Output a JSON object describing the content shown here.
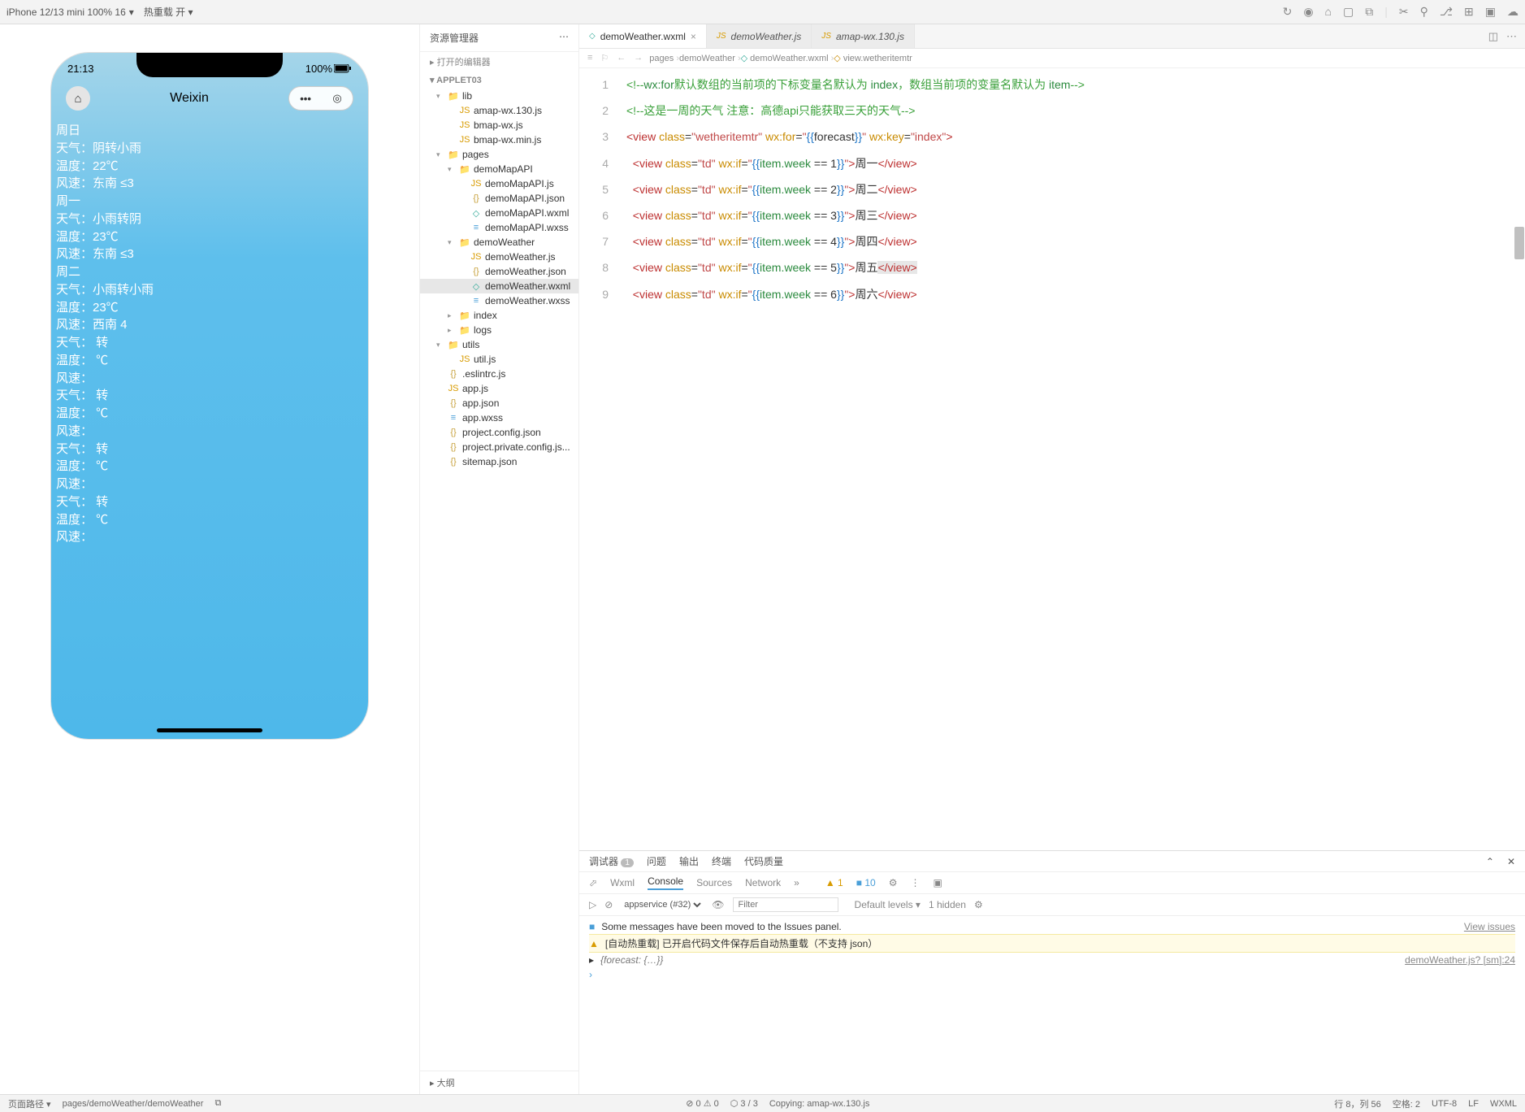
{
  "topbar": {
    "device": "iPhone 12/13 mini 100% 16",
    "reload": "热重载 开"
  },
  "simulator": {
    "time": "21:13",
    "battery": "100%",
    "title": "Weixin",
    "weather_lines": [
      "周日",
      "天气：阴转小雨",
      "温度：22℃",
      "风速：东南 ≤3",
      "周一",
      "天气：小雨转阴",
      "温度：23℃",
      "风速：东南 ≤3",
      "周二",
      "天气：小雨转小雨",
      "温度：23℃",
      "风速：西南 4",
      "天气： 转",
      "温度： ℃",
      "风速：",
      "天气： 转",
      "温度： ℃",
      "风速：",
      "天气： 转",
      "温度： ℃",
      "风速：",
      "天气： 转",
      "温度： ℃",
      "风速："
    ]
  },
  "explorer": {
    "title": "资源管理器",
    "open_editors": "打开的编辑器",
    "root": "APPLET03",
    "outline": "大纲",
    "tree": [
      {
        "d": 1,
        "chev": "▾",
        "ico": "fold",
        "name": "lib"
      },
      {
        "d": 2,
        "ico": "js",
        "name": "amap-wx.130.js"
      },
      {
        "d": 2,
        "ico": "js",
        "name": "bmap-wx.js"
      },
      {
        "d": 2,
        "ico": "js",
        "name": "bmap-wx.min.js"
      },
      {
        "d": 1,
        "chev": "▾",
        "ico": "fold",
        "name": "pages"
      },
      {
        "d": 2,
        "chev": "▾",
        "ico": "fold",
        "name": "demoMapAPI"
      },
      {
        "d": 3,
        "ico": "js",
        "name": "demoMapAPI.js"
      },
      {
        "d": 3,
        "ico": "json",
        "name": "demoMapAPI.json"
      },
      {
        "d": 3,
        "ico": "wxml",
        "name": "demoMapAPI.wxml"
      },
      {
        "d": 3,
        "ico": "wxss",
        "name": "demoMapAPI.wxss"
      },
      {
        "d": 2,
        "chev": "▾",
        "ico": "fold",
        "name": "demoWeather"
      },
      {
        "d": 3,
        "ico": "js",
        "name": "demoWeather.js"
      },
      {
        "d": 3,
        "ico": "json",
        "name": "demoWeather.json"
      },
      {
        "d": 3,
        "ico": "wxml",
        "name": "demoWeather.wxml",
        "sel": true
      },
      {
        "d": 3,
        "ico": "wxss",
        "name": "demoWeather.wxss"
      },
      {
        "d": 2,
        "chev": "▸",
        "ico": "fold",
        "name": "index"
      },
      {
        "d": 2,
        "chev": "▸",
        "ico": "fold",
        "name": "logs"
      },
      {
        "d": 1,
        "chev": "▾",
        "ico": "fold",
        "name": "utils"
      },
      {
        "d": 2,
        "ico": "js",
        "name": "util.js"
      },
      {
        "d": 1,
        "ico": "json",
        "name": ".eslintrc.js"
      },
      {
        "d": 1,
        "ico": "js",
        "name": "app.js"
      },
      {
        "d": 1,
        "ico": "json",
        "name": "app.json"
      },
      {
        "d": 1,
        "ico": "wxss",
        "name": "app.wxss"
      },
      {
        "d": 1,
        "ico": "json",
        "name": "project.config.json"
      },
      {
        "d": 1,
        "ico": "json",
        "name": "project.private.config.js..."
      },
      {
        "d": 1,
        "ico": "json",
        "name": "sitemap.json"
      }
    ]
  },
  "editor": {
    "tabs": [
      {
        "name": "demoWeather.wxml",
        "active": true,
        "ico": "wxml"
      },
      {
        "name": "demoWeather.js",
        "ico": "js"
      },
      {
        "name": "amap-wx.130.js",
        "ico": "js"
      }
    ],
    "breadcrumb": [
      "pages",
      "demoWeather",
      "demoWeather.wxml",
      "view.wetheritemtr"
    ],
    "lines": [
      {
        "n": 1,
        "html": "<span class='c-comment'>&lt;!--<span class='c-key'>wx:for</span>默认数组的当前项的下标变量名默认为 <span class='c-key'>index</span>，数组当前项的变量名默认为 <span class='c-key'>item</span>--&gt;</span>"
      },
      {
        "n": 2,
        "html": "<span class='c-comment'>&lt;!--这是一周的天气 注意：高德api只能获取三天的天气--&gt;</span>"
      },
      {
        "n": 3,
        "html": "<span class='c-tag'>&lt;view</span> <span class='c-attr'>class</span>=<span class='c-val'>\"wetheritemtr\"</span> <span class='c-attr'>wx:for</span>=<span class='c-val'>\"</span><span class='c-bind'>{{</span>forecast<span class='c-bind'>}}</span><span class='c-val'>\"</span> <span class='c-attr'>wx:key</span>=<span class='c-val'>\"index\"</span><span class='c-tag'>&gt;</span>"
      },
      {
        "n": 4,
        "html": "  <span class='c-tag'>&lt;view</span> <span class='c-attr'>class</span>=<span class='c-val'>\"td\"</span> <span class='c-attr'>wx:if</span>=<span class='c-val'>\"</span><span class='c-bind'>{{</span><span class='c-key'>item.week</span> == 1<span class='c-bind'>}}</span><span class='c-val'>\"</span><span class='c-tag'>&gt;</span>周一<span class='c-tag'>&lt;/view&gt;</span>"
      },
      {
        "n": 5,
        "html": "  <span class='c-tag'>&lt;view</span> <span class='c-attr'>class</span>=<span class='c-val'>\"td\"</span> <span class='c-attr'>wx:if</span>=<span class='c-val'>\"</span><span class='c-bind'>{{</span><span class='c-key'>item.week</span> == 2<span class='c-bind'>}}</span><span class='c-val'>\"</span><span class='c-tag'>&gt;</span>周二<span class='c-tag'>&lt;/view&gt;</span>"
      },
      {
        "n": 6,
        "html": "  <span class='c-tag'>&lt;view</span> <span class='c-attr'>class</span>=<span class='c-val'>\"td\"</span> <span class='c-attr'>wx:if</span>=<span class='c-val'>\"</span><span class='c-bind'>{{</span><span class='c-key'>item.week</span> == 3<span class='c-bind'>}}</span><span class='c-val'>\"</span><span class='c-tag'>&gt;</span>周三<span class='c-tag'>&lt;/view&gt;</span>"
      },
      {
        "n": 7,
        "html": "  <span class='c-tag'>&lt;view</span> <span class='c-attr'>class</span>=<span class='c-val'>\"td\"</span> <span class='c-attr'>wx:if</span>=<span class='c-val'>\"</span><span class='c-bind'>{{</span><span class='c-key'>item.week</span> == 4<span class='c-bind'>}}</span><span class='c-val'>\"</span><span class='c-tag'>&gt;</span>周四<span class='c-tag'>&lt;/view&gt;</span>"
      },
      {
        "n": 8,
        "html": "  <span class='c-tag'>&lt;view</span> <span class='c-attr'>class</span>=<span class='c-val'>\"td\"</span> <span class='c-attr'>wx:if</span>=<span class='c-val'>\"</span><span class='c-bind'>{{</span><span class='c-key'>item.week</span> == 5<span class='c-bind'>}}</span><span class='c-val'>\"</span><span class='c-tag'>&gt;</span>周五<span style='background:#e7e7e7'><span class='c-tag'>&lt;/view&gt;</span></span>"
      },
      {
        "n": 9,
        "html": "  <span class='c-tag'>&lt;view</span> <span class='c-attr'>class</span>=<span class='c-val'>\"td\"</span> <span class='c-attr'>wx:if</span>=<span class='c-val'>\"</span><span class='c-bind'>{{</span><span class='c-key'>item.week</span> == 6<span class='c-bind'>}}</span><span class='c-val'>\"</span><span class='c-tag'>&gt;</span>周六<span class='c-tag'>&lt;/view&gt;</span>"
      }
    ]
  },
  "debugger": {
    "main_tabs": {
      "t1": "调试器",
      "badge": "1",
      "t2": "问题",
      "t3": "输出",
      "t4": "终端",
      "t5": "代码质量"
    },
    "sub_tabs": {
      "t1": "Wxml",
      "t2": "Console",
      "t3": "Sources",
      "t4": "Network"
    },
    "warn_count": "1",
    "info_count": "10",
    "context": "appservice (#32)",
    "filter_placeholder": "Filter",
    "levels": "Default levels",
    "hidden": "1 hidden",
    "msg1": "Some messages have been moved to the Issues panel.",
    "msg1_link": "View issues",
    "msg2": "[自动热重载] 已开启代码文件保存后自动热重载（不支持 json）",
    "msg3": "{forecast: {…}}",
    "msg3_link": "demoWeather.js? [sm]:24"
  },
  "status": {
    "path_label": "页面路径",
    "path": "pages/demoWeather/demoWeather",
    "problems": "⊘ 0 ⚠ 0",
    "stash": "⬡ 3 / 3",
    "copying": "Copying: amap-wx.130.js",
    "pos": "行 8，列 56",
    "spaces": "空格: 2",
    "enc": "UTF-8",
    "eol": "LF",
    "lang": "WXML"
  }
}
